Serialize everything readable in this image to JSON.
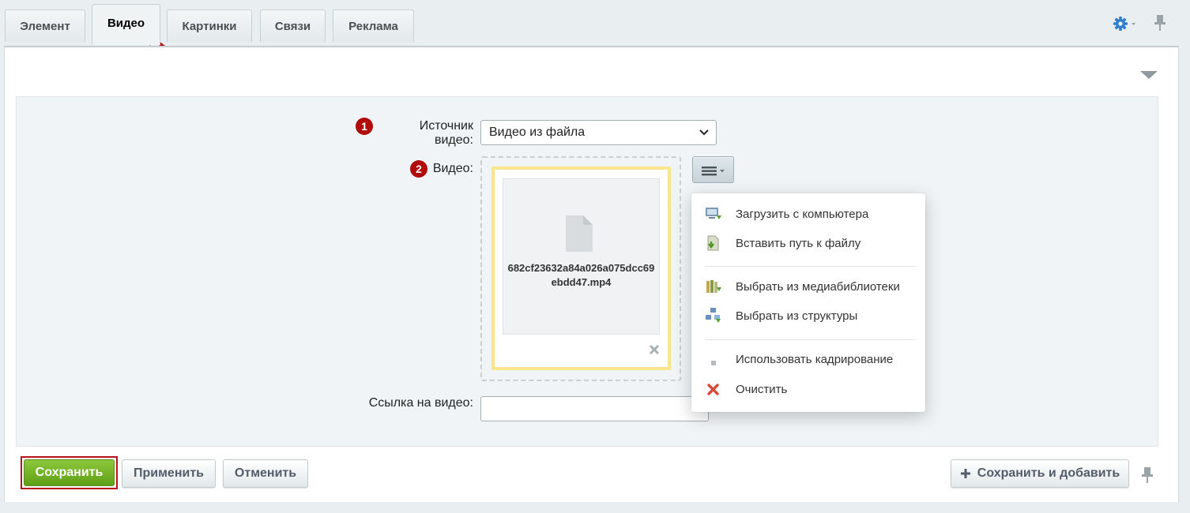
{
  "tabs": [
    "Элемент",
    "Видео",
    "Картинки",
    "Связи",
    "Реклама"
  ],
  "active_tab": "Видео",
  "form": {
    "video_source": {
      "step": "1",
      "label": "Источник видео:",
      "value": "Видео из файла"
    },
    "video": {
      "step": "2",
      "label": "Видео:",
      "filename": "682cf23632a84a026a075dcc69ebdd47.mp4"
    },
    "video_link": {
      "label": "Ссылка на видео:",
      "value": ""
    }
  },
  "menu": {
    "items": [
      {
        "label": "Загрузить с компьютера",
        "icon": "upload-computer-icon"
      },
      {
        "label": "Вставить путь к файлу",
        "icon": "insert-path-icon"
      },
      {
        "label": "Выбрать из медиабиблиотеки",
        "icon": "medialibrary-icon"
      },
      {
        "label": "Выбрать из структуры",
        "icon": "structure-icon"
      },
      {
        "label": "Использовать кадрирование",
        "icon": "crop-dot-icon"
      },
      {
        "label": "Очистить",
        "icon": "clear-x-icon"
      }
    ]
  },
  "buttons": {
    "save": "Сохранить",
    "apply": "Применить",
    "cancel": "Отменить",
    "save_and_add": "Сохранить и добавить"
  },
  "colors": {
    "save_green": "#6fae22",
    "highlight_red": "#b5121b",
    "step_badge": "#b10a0a",
    "gear_blue": "#2f7fd1",
    "file_border_yellow": "#fbe58c"
  }
}
